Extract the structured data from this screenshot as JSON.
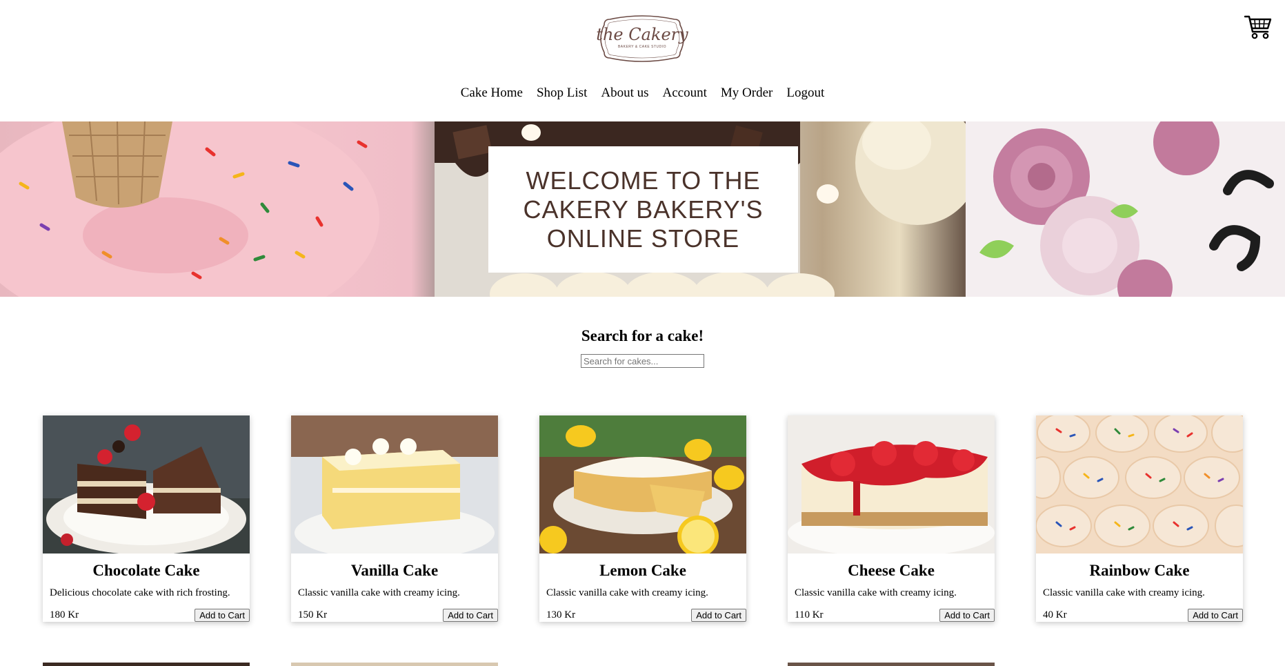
{
  "brand": {
    "logo_text": "the Cakery",
    "logo_sub": "BAKERY & CAKE STUDIO"
  },
  "nav": [
    "Cake Home",
    "Shop List",
    "About us",
    "Account",
    "My Order",
    "Logout"
  ],
  "hero": {
    "title": "WELCOME TO THE CAKERY BAKERY'S ONLINE STORE"
  },
  "search": {
    "title": "Search for a cake!",
    "placeholder": "Search for cakes..."
  },
  "products": [
    {
      "name": "Chocolate Cake",
      "description": "Delicious chocolate cake with rich frosting.",
      "price": "180 Kr",
      "button": "Add to Cart",
      "image_icon": "chocolate-cake-image"
    },
    {
      "name": "Vanilla Cake",
      "description": "Classic vanilla cake with creamy icing.",
      "price": "150 Kr",
      "button": "Add to Cart",
      "image_icon": "vanilla-cake-image"
    },
    {
      "name": "Lemon Cake",
      "description": "Classic vanilla cake with creamy icing.",
      "price": "130 Kr",
      "button": "Add to Cart",
      "image_icon": "lemon-cake-image"
    },
    {
      "name": "Cheese Cake",
      "description": "Classic vanilla cake with creamy icing.",
      "price": "110 Kr",
      "button": "Add to Cart",
      "image_icon": "cheese-cake-image"
    },
    {
      "name": "Rainbow Cake",
      "description": "Classic vanilla cake with creamy icing.",
      "price": "40 Kr",
      "button": "Add to Cart",
      "image_icon": "rainbow-cake-image"
    }
  ],
  "colors": {
    "brand_brown": "#4a322a",
    "hero_pink": "#f4c4cc"
  }
}
